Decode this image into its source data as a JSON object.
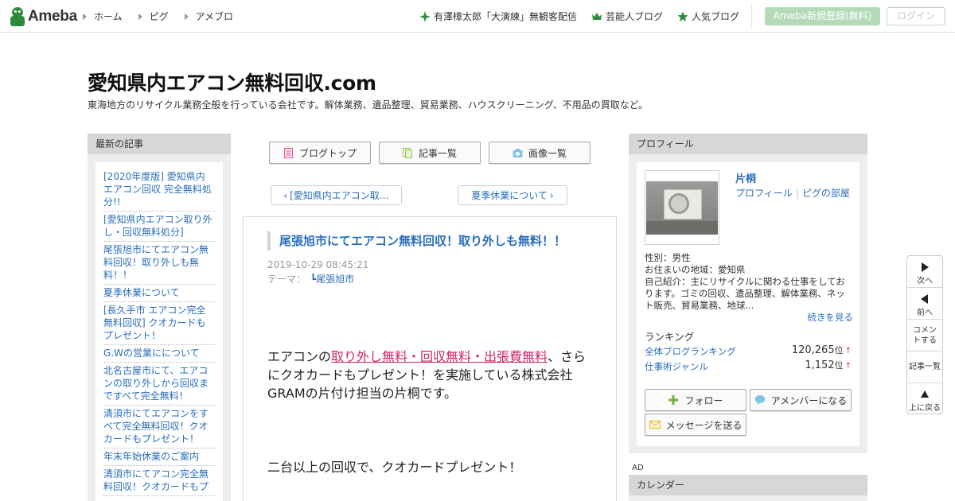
{
  "topbar": {
    "logo_text": "Ameba",
    "nav": [
      "ホーム",
      "ピグ",
      "アメブロ"
    ],
    "links": [
      {
        "label": "有澤樟太郎「大演練」無観客配信",
        "icon": "sparkle-icon"
      },
      {
        "label": "芸能人ブログ",
        "icon": "crown-icon"
      },
      {
        "label": "人気ブログ",
        "icon": "star-icon"
      }
    ],
    "register_label": "Ameba新規登録(無料)",
    "login_label": "ログイン",
    "brand_color": "#2d8c3c"
  },
  "header": {
    "title": "愛知県内エアコン無料回収.com",
    "description": "東海地方のリサイクル業務全般を行っている会社です。解体業務、遺品整理、貿易業務、ハウスクリーニング、不用品の買取など。"
  },
  "left_sidebar": {
    "heading": "最新の記事",
    "posts": [
      "[2020年度版] 愛知県内 エアコン回収 完全無料処分!!",
      "[愛知県内エアコン取り外し・回収無料処分]",
      "尾張旭市にてエアコン無料回収！取り外しも無料！！",
      "夏季休業について",
      "[長久手市 エアコン完全無料回収] クオカードもプレゼント！",
      "G.Wの営業にについて",
      "北名古屋市にて、エアコンの取り外しから回収まですべて完全無料！",
      "清須市にてエアコンをすべて完全無料回収！クオカードもプレゼント！",
      "年末年始休業のご案内",
      "清須市にてアコン完全無料回収！クオカードもプ"
    ]
  },
  "main": {
    "buttons": [
      {
        "label": "ブログトップ",
        "icon": "home-doc-icon"
      },
      {
        "label": "記事一覧",
        "icon": "list-doc-icon"
      },
      {
        "label": "画像一覧",
        "icon": "camera-icon"
      }
    ],
    "prev_label": "[愛知県内エアコン取…",
    "next_label": "夏季休業について",
    "article": {
      "title": "尾張旭市にてエアコン無料回収！取り外しも無料！！",
      "date": "2019-10-29 08:45:21",
      "theme_label": "テーマ：",
      "theme": "┗尾張旭市",
      "para_pre": "エアコンの",
      "para_highlight": "取り外し無料・回収無料・出張費無料",
      "para_post": "、さらにクオカードもプレゼント！を実施している株式会社GRAMの片付け担当の片桐です。",
      "para2": "二台以上の回収で、クオカードプレゼント！",
      "highlight_color": "#cc2566"
    }
  },
  "profile": {
    "heading": "プロフィール",
    "name": "片桐",
    "link_profile": "プロフィール",
    "link_room": "ピグの部屋",
    "link_separator": "|",
    "gender": "性別：男性",
    "area": "お住まいの地域：愛知県",
    "intro": "自己紹介：主にリサイクルに関わる仕事をしております。ゴミの回収、遺品整理、解体業務、ネット販売、貿易業務、地球...",
    "more": "続きを見る",
    "ranking_heading": "ランキング",
    "rankings": [
      {
        "label": "全体ブログランキング",
        "value": "120,265",
        "unit": "位",
        "trend": "↑"
      },
      {
        "label": "仕事術ジャンル",
        "value": "1,152",
        "unit": "位",
        "trend": "↑"
      }
    ],
    "follow_label": "フォロー",
    "amember_label": "アメンバーになる",
    "message_label": "メッセージを送る"
  },
  "ad_label": "AD",
  "calendar_heading": "カレンダー",
  "floatnav": [
    {
      "label": "次へ",
      "icon": "next-icon"
    },
    {
      "label": "前へ",
      "icon": "prev-icon"
    },
    {
      "label": "コメントする",
      "icon": ""
    },
    {
      "label": "記事一覧",
      "icon": ""
    },
    {
      "label": "上に戻る",
      "icon": "up-icon"
    }
  ]
}
